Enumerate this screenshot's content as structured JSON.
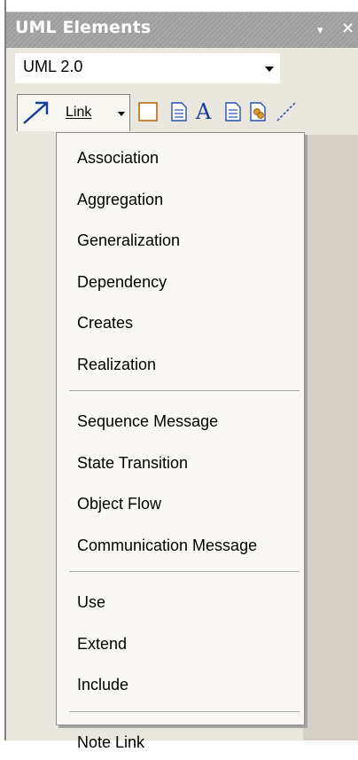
{
  "window": {
    "title": "UML Elements",
    "pin_glyph": "▾",
    "close_glyph": "✕"
  },
  "combo": {
    "value": "UML 2.0"
  },
  "toolbar": {
    "link_label": "Link",
    "icons": [
      "link-arrow-icon",
      "rectangle-icon",
      "note-icon",
      "text-icon",
      "document-icon",
      "hyperlink-icon",
      "dashed-line-icon"
    ]
  },
  "menu": {
    "groups": [
      [
        "Association",
        "Aggregation",
        "Generalization",
        "Dependency",
        "Creates",
        "Realization"
      ],
      [
        "Sequence Message",
        "State Transition",
        "Object Flow",
        "Communication Message"
      ],
      [
        "Use",
        "Extend",
        "Include"
      ],
      [
        "Note Link"
      ]
    ]
  },
  "colors": {
    "title_bar": "#a3a3a3",
    "toolbar_bg": "#eae7de",
    "menu_bg": "#f9f8f4"
  }
}
